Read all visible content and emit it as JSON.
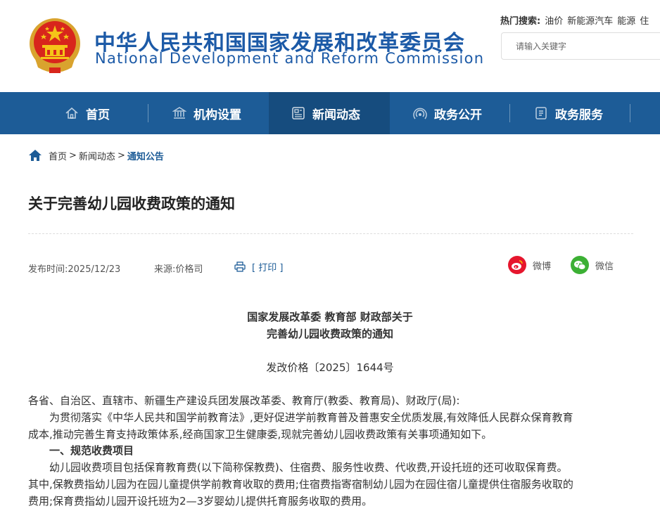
{
  "header": {
    "title_cn": "中华人民共和国国家发展和改革委员会",
    "title_en": "National Development and Reform Commission",
    "hot_label": "热门搜索:",
    "hot_terms": [
      "油价",
      "新能源汽车",
      "能源",
      "住"
    ],
    "search_placeholder": "请输入关键字"
  },
  "nav": {
    "items": [
      {
        "label": "首页",
        "icon": "home-icon"
      },
      {
        "label": "机构设置",
        "icon": "institution-icon"
      },
      {
        "label": "新闻动态",
        "icon": "news-icon"
      },
      {
        "label": "政务公开",
        "icon": "broadcast-icon"
      },
      {
        "label": "政务服务",
        "icon": "service-icon"
      }
    ],
    "active": "新闻动态"
  },
  "breadcrumb": {
    "items": [
      "首页",
      "新闻动态",
      "通知公告"
    ],
    "separator": ">"
  },
  "article": {
    "title": "关于完善幼儿园收费政策的通知",
    "publish_label": "发布时间:",
    "publish_date": "2025/12/23",
    "source_label": "来源:",
    "source": "价格司",
    "print_label": "[ 打印 ]",
    "share_weibo": "微博",
    "share_wechat": "微信",
    "doc_head_line1": "国家发展改革委 教育部 财政部关于",
    "doc_head_line2": "完善幼儿园收费政策的通知",
    "doc_number": "发改价格〔2025〕1644号",
    "paragraphs": [
      "各省、自治区、直辖市、新疆生产建设兵团发展改革委、教育厅(教委、教育局)、财政厅(局):",
      "　　为贯彻落实《中华人民共和国学前教育法》,更好促进学前教育普及普惠安全优质发展,有效降低人民群众保育教育",
      "成本,推动完善生育支持政策体系,经商国家卫生健康委,现就完善幼儿园收费政策有关事项通知如下。",
      "　　一、规范收费项目",
      "　　幼儿园收费项目包括保育教育费(以下简称保教费)、住宿费、服务性收费、代收费,开设托班的还可收取保育费。",
      "其中,保教费指幼儿园为在园儿童提供学前教育收取的费用;住宿费指寄宿制幼儿园为在园住宿儿童提供住宿服务收取的",
      "费用;保育费指幼儿园开设托班为2—3岁婴幼儿提供托育服务收取的费用。"
    ]
  },
  "colors": {
    "brand": "#1c5aa7",
    "nav_bg": "#1d5c97",
    "nav_active": "#164c7e",
    "weibo": "#e6162d",
    "wechat": "#3cb034"
  }
}
